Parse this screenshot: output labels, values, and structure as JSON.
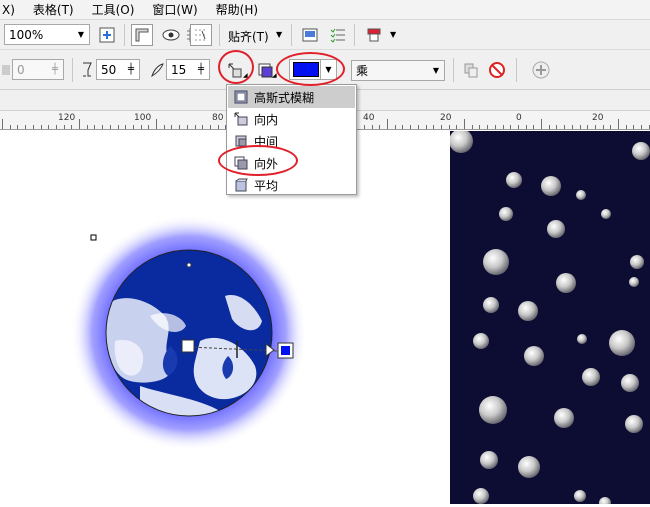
{
  "menubar": {
    "items": [
      "X)",
      "表格(T)",
      "工具(O)",
      "窗口(W)",
      "帮助(H)"
    ]
  },
  "toolbar1": {
    "zoom_value": "100%",
    "snap_label": "贴齐(T)"
  },
  "toolbar2": {
    "field0_value": "0",
    "opacity_value": "50",
    "feather_value": "15",
    "merge_mode_value": "乘",
    "shadow_color": "#0010f0"
  },
  "dropdown": {
    "items": [
      {
        "label": "高斯式模糊",
        "selected": true
      },
      {
        "label": "向内",
        "selected": false
      },
      {
        "label": "中间",
        "selected": false
      },
      {
        "label": "向外",
        "selected": false
      },
      {
        "label": "平均",
        "selected": false
      }
    ]
  },
  "ruler": {
    "labels": [
      "120",
      "100",
      "80",
      "40",
      "20",
      "0",
      "20"
    ]
  },
  "colors": {
    "accent_red": "#e0202a",
    "dark_pane": "#0d0c33",
    "glow": "#6e6cff",
    "planet_blue": "#0a2aa0"
  }
}
